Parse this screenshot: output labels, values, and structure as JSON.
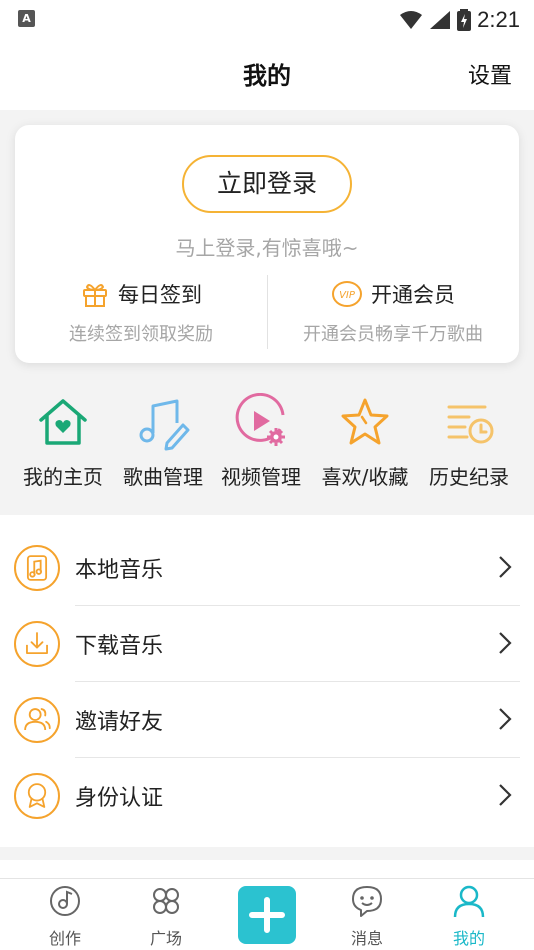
{
  "statusbar": {
    "time": "2:21"
  },
  "header": {
    "title": "我的",
    "settings_label": "设置"
  },
  "login_card": {
    "login_button": "立即登录",
    "tip": "马上登录,有惊喜哦~",
    "checkin": {
      "label": "每日签到",
      "sub": "连续签到领取奖励"
    },
    "vip": {
      "label": "开通会员",
      "sub": "开通会员畅享千万歌曲",
      "badge": "VIP"
    }
  },
  "quick_entries": [
    {
      "label": "我的主页",
      "icon": "home-heart-icon"
    },
    {
      "label": "歌曲管理",
      "icon": "music-edit-icon"
    },
    {
      "label": "视频管理",
      "icon": "video-settings-icon"
    },
    {
      "label": "喜欢/收藏",
      "icon": "star-icon"
    },
    {
      "label": "历史纪录",
      "icon": "history-list-icon"
    }
  ],
  "menu": [
    {
      "label": "本地音乐",
      "icon": "local-music-icon"
    },
    {
      "label": "下载音乐",
      "icon": "download-icon"
    },
    {
      "label": "邀请好友",
      "icon": "invite-friends-icon"
    },
    {
      "label": "身份认证",
      "icon": "badge-icon"
    }
  ],
  "tabbar": {
    "items": [
      {
        "label": "创作",
        "icon": "create-disc-icon"
      },
      {
        "label": "广场",
        "icon": "clover-icon"
      },
      {
        "label": "消息",
        "icon": "message-icon"
      },
      {
        "label": "我的",
        "icon": "profile-icon"
      }
    ],
    "active": "我的"
  },
  "colors": {
    "accent_orange": "#f5a32d",
    "accent_teal": "#2bc2d0",
    "green": "#1aa876",
    "blue": "#6fb8ea",
    "pink": "#e16aa0"
  }
}
